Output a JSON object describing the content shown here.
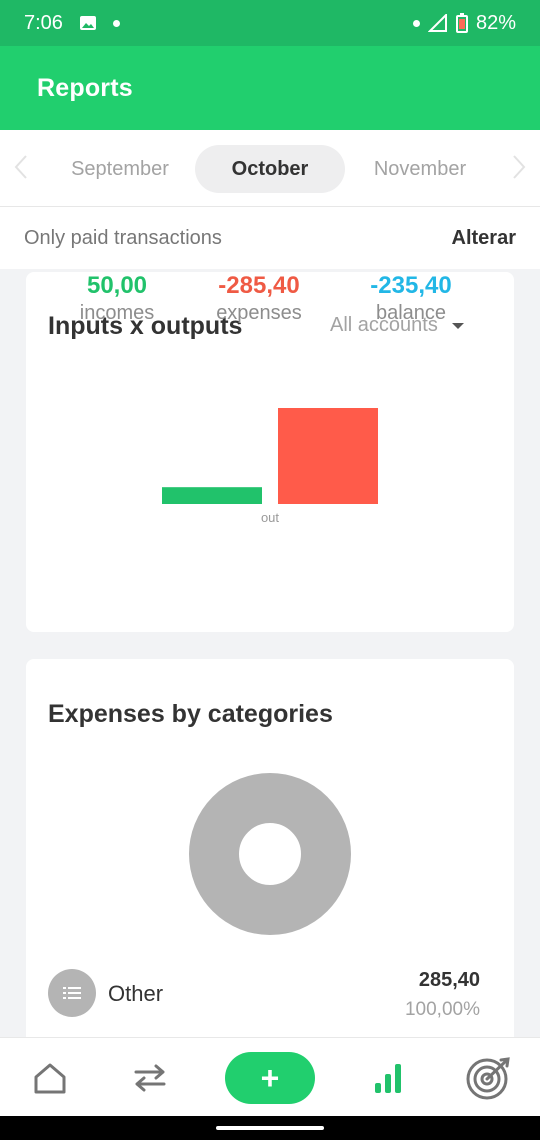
{
  "status_bar": {
    "time": "7:06",
    "battery": "82%"
  },
  "app_bar": {
    "title": "Reports"
  },
  "months": {
    "prev": "September",
    "current": "October",
    "next": "November"
  },
  "filter": {
    "label": "Only paid transactions",
    "action": "Alterar"
  },
  "inputs_outputs": {
    "title": "Inputs x outputs",
    "account_select": "All accounts",
    "stats": {
      "incomes_value": "50,00",
      "incomes_label": "incomes",
      "expenses_value": "-285,40",
      "expenses_label": "expenses",
      "balance_value": "-235,40",
      "balance_label": "balance"
    }
  },
  "chart_data": {
    "type": "bar",
    "categories": [
      "out"
    ],
    "series": [
      {
        "name": "incomes",
        "values": [
          50.0
        ],
        "color": "#21c26b"
      },
      {
        "name": "expenses",
        "values": [
          285.4
        ],
        "color": "#ff5b4a"
      }
    ],
    "xlabel": "",
    "ylabel": "",
    "grid": false
  },
  "categories_card": {
    "title": "Expenses by categories",
    "slices": [
      {
        "label": "Other",
        "value": "285,40",
        "percent": "100,00%",
        "color": "#b4b4b4"
      }
    ]
  },
  "nav": {
    "items": [
      "home-icon",
      "transfer-icon",
      "add-icon",
      "reports-icon",
      "goals-icon"
    ],
    "fab_label": "+",
    "active_color": "#21c26b"
  }
}
